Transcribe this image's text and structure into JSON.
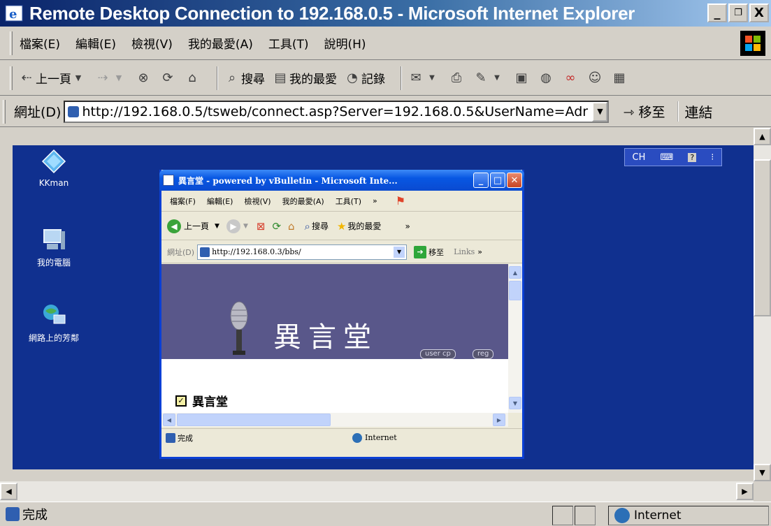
{
  "window": {
    "title": "Remote Desktop Connection to 192.168.0.5 - Microsoft Internet Explorer",
    "ctrl_min": "_",
    "ctrl_max": "̥",
    "ctrl_close": "X"
  },
  "menu": {
    "items": [
      "檔案(E)",
      "編輯(E)",
      "檢視(V)",
      "我的最愛(A)",
      "工具(T)",
      "說明(H)"
    ]
  },
  "toolbar": {
    "back_label": "上一頁",
    "search_label": "搜尋",
    "favorites_label": "我的最愛",
    "history_label": "記錄"
  },
  "address": {
    "label": "網址(D)",
    "url": "http://192.168.0.5/tsweb/connect.asp?Server=192.168.0.5&UserName=Adr",
    "go_label": "移至",
    "links_label": "連結"
  },
  "desktop": {
    "icons": [
      {
        "label": "KKman"
      },
      {
        "label": "我的電腦"
      },
      {
        "label": "網路上的芳鄰"
      }
    ],
    "lang_bar": "CH"
  },
  "inner": {
    "title": "異言堂 - powered by vBulletin - Microsoft Inte...",
    "menu": [
      "檔案(F)",
      "編輯(E)",
      "檢視(V)",
      "我的最愛(A)",
      "工具(T)"
    ],
    "back_label": "上一頁",
    "search_label": "搜尋",
    "favorites_label": "我的最愛",
    "addr_label": "網址(D)",
    "url": "http://192.168.0.3/bbs/",
    "go_label": "移至",
    "links_label": "Links",
    "banner_title": "異言堂",
    "btn_usercp": "user cp",
    "btn_reg": "reg",
    "forum_heading": "異言堂",
    "status_text": "完成",
    "zone_text": "Internet"
  },
  "status": {
    "text": "完成",
    "zone": "Internet"
  },
  "colors": {
    "desktop": "#10308f",
    "banner": "#59578a",
    "title_start": "#0a246a"
  }
}
